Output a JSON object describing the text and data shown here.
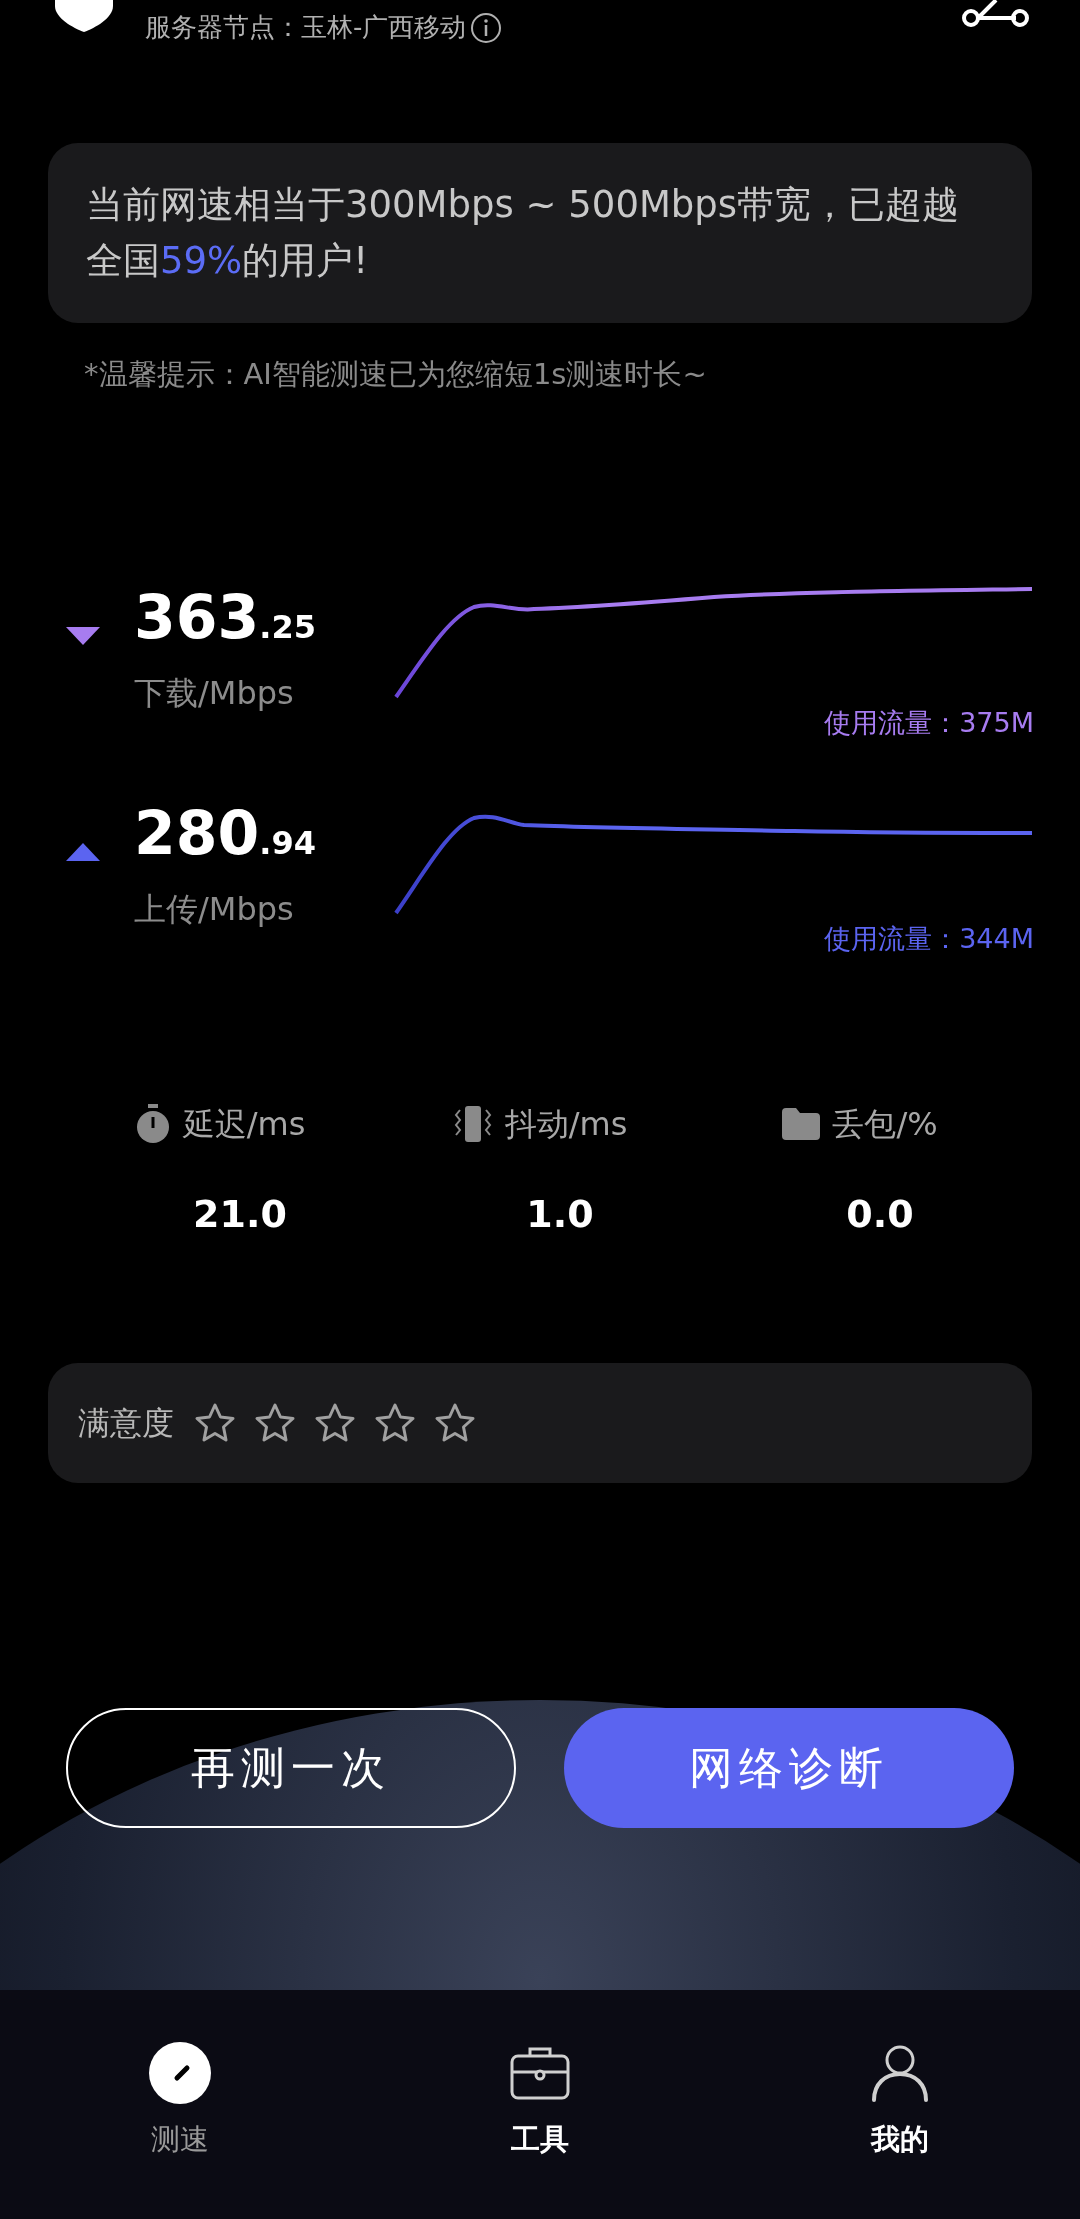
{
  "header": {
    "server_node": "服务器节点：玉林-广西移动"
  },
  "summary": {
    "text": "当前网速相当于300Mbps ~ 500Mbps带宽，已超越全国",
    "highlight": "59%",
    "suffix": "的用户!"
  },
  "hint": "*温馨提示：AI智能测速已为您缩短1s测速时长~",
  "speeds": [
    {
      "kind": "download",
      "integer": "363",
      "decimal": ".25",
      "label": "下载/Mbps",
      "traffic": "使用流量：375M",
      "color": "#a77cf0"
    },
    {
      "kind": "upload",
      "integer": "280",
      "decimal": ".94",
      "label": "上传/Mbps",
      "traffic": "使用流量：344M",
      "color": "#5b64f0"
    }
  ],
  "metrics": [
    {
      "kind": "latency",
      "label": "延迟/ms",
      "value": "21.0"
    },
    {
      "kind": "jitter",
      "label": "抖动/ms",
      "value": "1.0"
    },
    {
      "kind": "loss",
      "label": "丢包/%",
      "value": "0.0"
    }
  ],
  "rating": {
    "label": "满意度",
    "stars": 0
  },
  "buttons": [
    {
      "kind": "outline",
      "label": "再测一次"
    },
    {
      "kind": "primary",
      "label": "网络诊断"
    }
  ],
  "nav": [
    {
      "kind": "speed",
      "label": "测速",
      "selected": true
    },
    {
      "kind": "tools",
      "label": "工具",
      "selected": false
    },
    {
      "kind": "me",
      "label": "我的",
      "selected": false
    }
  ]
}
